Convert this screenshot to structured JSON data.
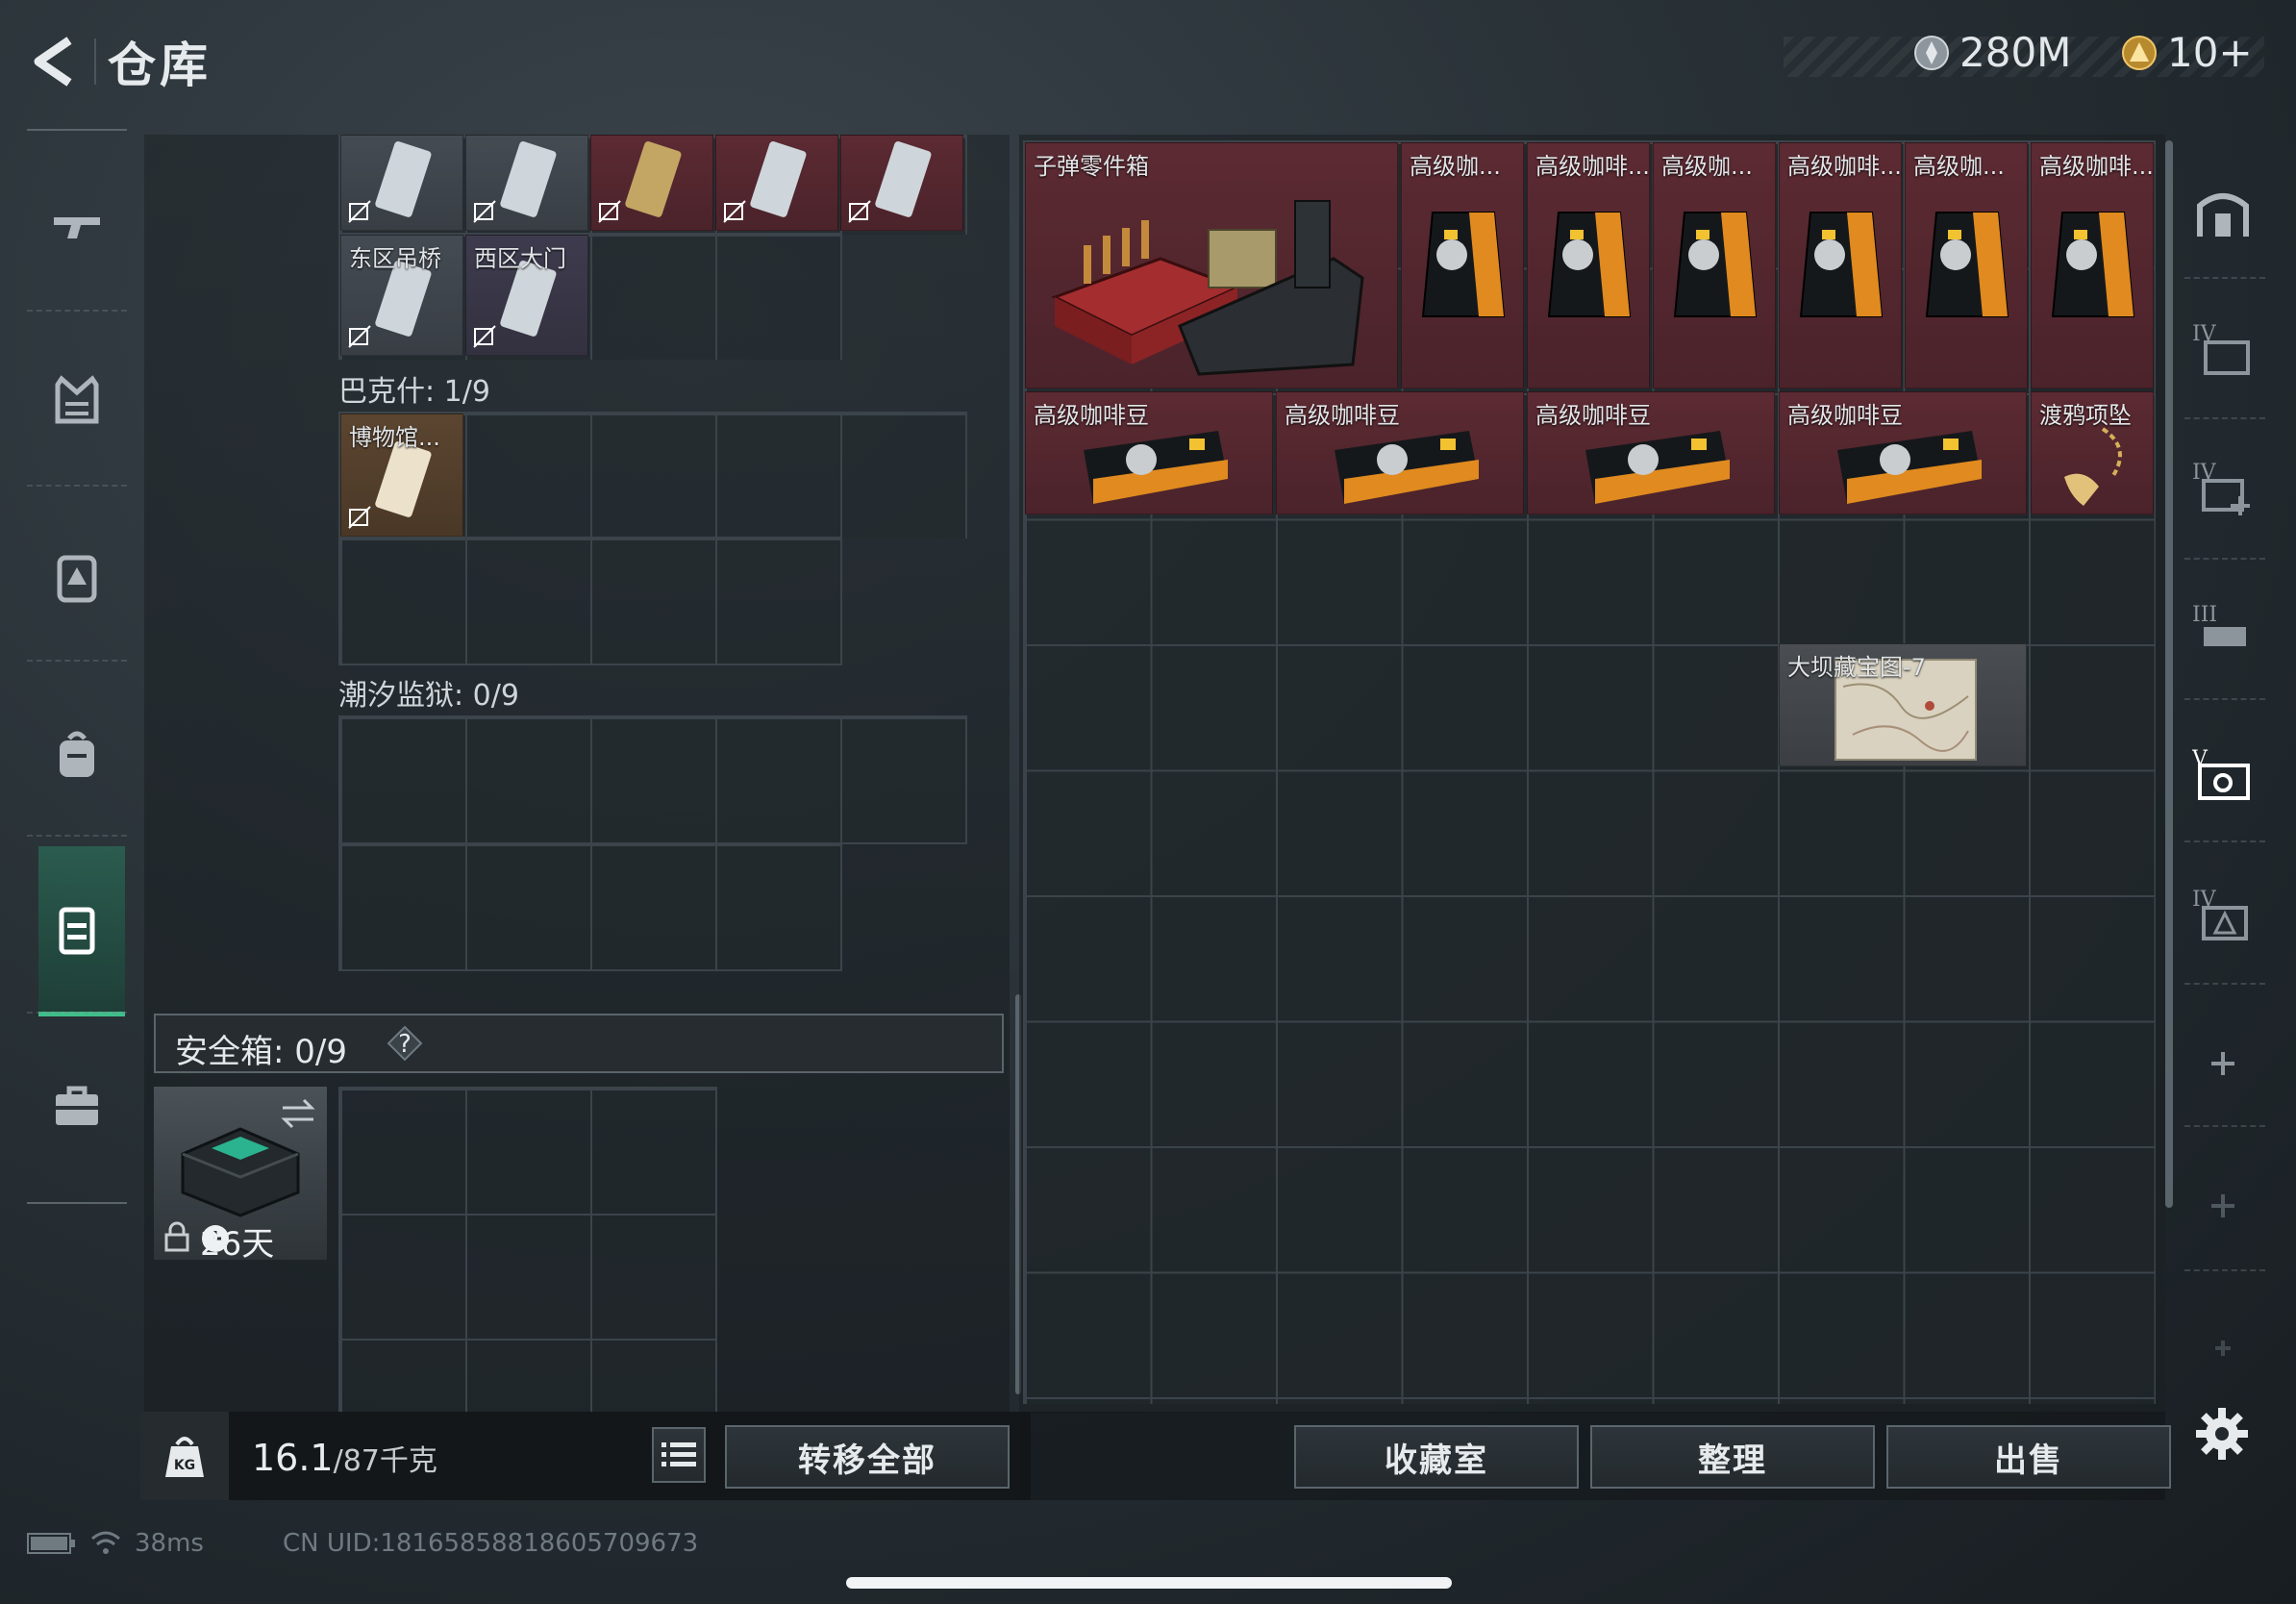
{
  "header": {
    "title": "仓库",
    "currency_1": "280M",
    "currency_2": "10+"
  },
  "left": {
    "row2_labels": [
      "东区吊桥",
      "西区大门"
    ],
    "section_bakesh": "巴克什: 1/9",
    "bakesh_item": "博物馆...",
    "section_tide": "潮汐监狱: 0/9",
    "safebox_label": "安全箱: 0/9",
    "safebox_help": "?",
    "safebox_days": "26天"
  },
  "right": {
    "items": [
      {
        "label": "子弹零件箱",
        "kind": "ammo"
      },
      {
        "label": "高级咖...",
        "kind": "coffee"
      },
      {
        "label": "高级咖啡...",
        "kind": "coffee"
      },
      {
        "label": "高级咖...",
        "kind": "coffee"
      },
      {
        "label": "高级咖啡...",
        "kind": "coffee"
      },
      {
        "label": "高级咖...",
        "kind": "coffee"
      },
      {
        "label": "高级咖啡...",
        "kind": "coffee"
      }
    ],
    "row2": [
      "高级咖啡豆",
      "高级咖啡豆",
      "高级咖啡豆",
      "高级咖啡豆"
    ],
    "necklace": "渡鸦项坠",
    "map_item": "大坝藏宝图-7"
  },
  "bottom": {
    "weight_current": "16.1",
    "weight_total": "/87千克",
    "transfer_all": "转移全部",
    "collection": "收藏室",
    "sort": "整理",
    "sell": "出售"
  },
  "footer": {
    "ping": "38ms",
    "uid": "CN UID:18165858818605709673"
  },
  "colors": {
    "accent": "#3fbf8a",
    "item_red": "#5c2a32",
    "item_gold": "#5b4530"
  },
  "icons": [
    "back-arrow-icon",
    "silver-coin-icon",
    "gold-coin-icon",
    "gun-icon",
    "armor-icon",
    "backpack-icon",
    "chest-rig-icon",
    "case-icon",
    "toolbox-icon",
    "lock-icon",
    "list-icon",
    "gear-icon",
    "plus-icon",
    "no-loot-icon"
  ]
}
